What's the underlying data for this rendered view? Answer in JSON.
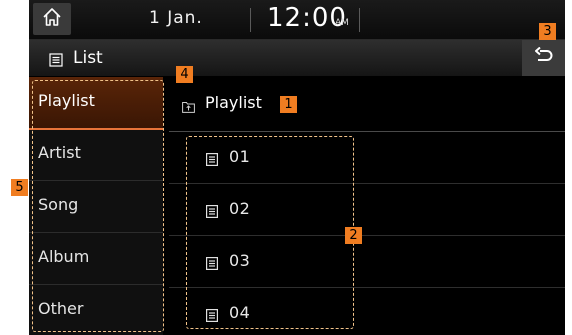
{
  "status_bar": {
    "date": "1 Jan.",
    "time": "12:00",
    "ampm": "AM",
    "home_icon": "home-icon"
  },
  "header": {
    "title": "List",
    "list_icon": "list-icon",
    "back_icon": "back-arrow-icon"
  },
  "sidebar": {
    "items": [
      {
        "label": "Playlist",
        "active": true
      },
      {
        "label": "Artist"
      },
      {
        "label": "Song"
      },
      {
        "label": "Album"
      },
      {
        "label": "Other"
      }
    ]
  },
  "main": {
    "folder_label": "Playlist",
    "folder_icon": "folder-up-icon",
    "files": [
      {
        "label": "01"
      },
      {
        "label": "02"
      },
      {
        "label": "03"
      },
      {
        "label": "04"
      }
    ]
  },
  "callouts": [
    "1",
    "2",
    "3",
    "4",
    "5"
  ],
  "colors": {
    "accent": "#f07d21",
    "active_tab": "#4a1e06",
    "dash_outline": "#f2c38a"
  }
}
